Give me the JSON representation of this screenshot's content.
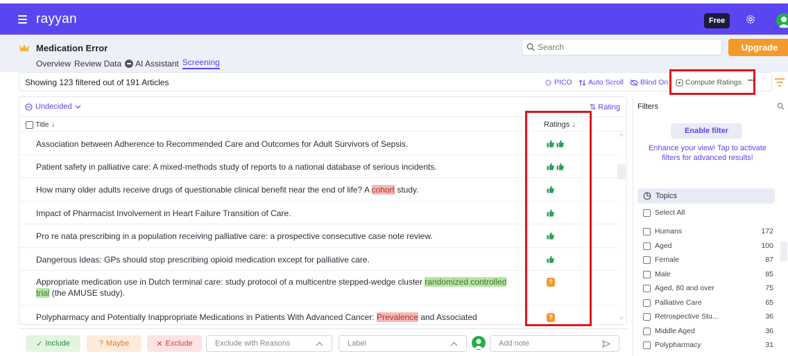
{
  "app": {
    "logo": "rayyan",
    "plan_badge": "Free",
    "upgrade_label": "Upgrade"
  },
  "project": {
    "title": "Medication Error",
    "tabs": [
      "Overview",
      "Review Data",
      "AI Assistant",
      "Screening"
    ],
    "active_tab": "Screening"
  },
  "search": {
    "placeholder": "Search"
  },
  "toolbar": {
    "showing": "Showing 123 filtered out of 191 Articles",
    "pico": "PICO",
    "auto_scroll": "Auto Scroll",
    "blind_on": "Blind On",
    "compute_ratings": "Compute Ratings",
    "more": "•••"
  },
  "list": {
    "filter_label": "Undecided",
    "sort_label": "Rating",
    "col_title": "Title",
    "col_ratings": "Ratings",
    "arrow": "↓",
    "rows": [
      {
        "pre": "Association between Adherence to Recommended Care and Outcomes for Adult Survivors of Sepsis.",
        "rating": "like2"
      },
      {
        "pre": "Patient safety in palliative care: A mixed-methods study of reports to a national database of serious incidents.",
        "rating": "like2"
      },
      {
        "pre": "How many older adults receive drugs of questionable clinical benefit near the end of life? A ",
        "hl": "cohort",
        "hl_color": "red",
        "post": " study.",
        "rating": "like1"
      },
      {
        "pre": "Impact of Pharmacist Involvement in Heart Failure Transition of Care.",
        "rating": "like1"
      },
      {
        "pre": "Pro re nata prescribing in a population receiving palliative care: a prospective consecutive case note review.",
        "rating": "like1"
      },
      {
        "pre": "Dangerous Ideas: GPs should stop prescribing opioid medication except for palliative care.",
        "rating": "like1"
      },
      {
        "pre": "Appropriate medication use in Dutch terminal care: study protocol of a multicentre stepped-wedge cluster ",
        "hl": "randomized controlled trial",
        "hl_color": "green",
        "post": " (the AMUSE study).",
        "rating": "maybe"
      },
      {
        "pre": "Polypharmacy and Potentially Inappropriate Medications in Patients With Advanced Cancer: ",
        "hl": "Prevalence",
        "hl_color": "red",
        "post": " and Associated",
        "rating": "maybe"
      }
    ]
  },
  "actions": {
    "include": "Include",
    "maybe": "Maybe",
    "exclude": "Exclude",
    "exclude_reasons": "Exclude with Reasons",
    "label": "Label",
    "add_note": "Add note",
    "maybe_mark": "?"
  },
  "filters": {
    "title": "Filters",
    "enable_label": "Enable filter",
    "hint": "Enhance your view! Tap to activate filters for advanced results!",
    "topics_label": "Topics",
    "select_all": "Select All",
    "items": [
      {
        "label": "Humans",
        "count": "172"
      },
      {
        "label": "Aged",
        "count": "100"
      },
      {
        "label": "Female",
        "count": "87"
      },
      {
        "label": "Male",
        "count": "85"
      },
      {
        "label": "Aged, 80 and over",
        "count": "75"
      },
      {
        "label": "Palliative Care",
        "count": "65"
      },
      {
        "label": "Retrospective Stu...",
        "count": "36"
      },
      {
        "label": "Middle Aged",
        "count": "36"
      },
      {
        "label": "Polypharmacy",
        "count": "31"
      }
    ]
  },
  "colors": {
    "brand": "#5a46f0",
    "upgrade": "#f39a2a",
    "like": "#2e9e5b",
    "maybe": "#f39a2a",
    "annotation": "#e0141c"
  }
}
